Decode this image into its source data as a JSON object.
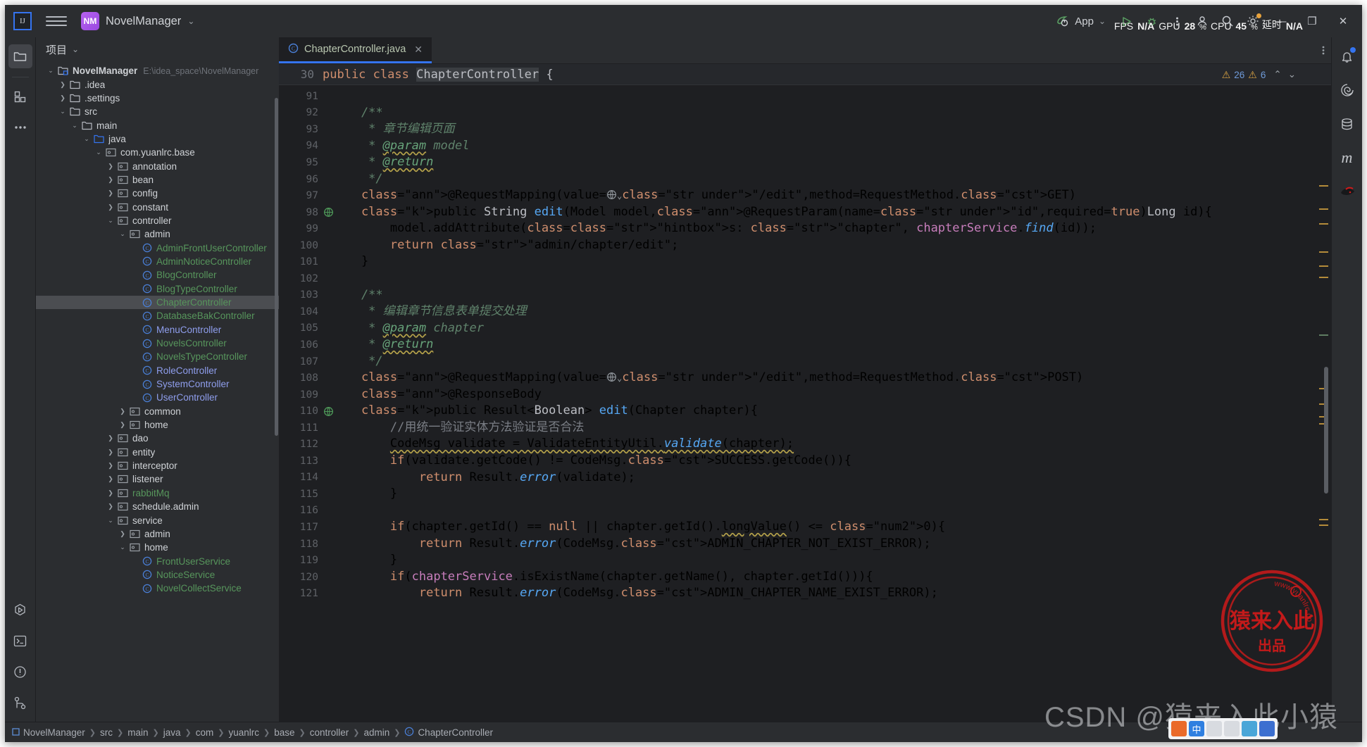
{
  "titlebar": {
    "ide_logo": "IJ",
    "menu_icon": "hamburger-menu-icon",
    "project_badge": "NM",
    "project_name": "NovelManager",
    "project_chevron": "⌄",
    "run_config": "App",
    "run_chevron": "⌄",
    "run_icon": "run-icon",
    "debug_icon": "debug-icon",
    "more_icon": "more-options-icon",
    "account_icon": "account-icon",
    "search_icon": "search-icon",
    "settings_icon": "settings-icon",
    "minimize": "—",
    "maximize": "❐",
    "close": "✕"
  },
  "perf_overlay": {
    "fps_label": "FPS",
    "fps_value": "N/A",
    "gpu_label": "GPU",
    "gpu_value": "28",
    "gpu_unit": "%",
    "cpu_label": "CPU",
    "cpu_value": "45",
    "cpu_unit": "%",
    "latency_label": "延时",
    "latency_value": "N/A"
  },
  "left_rail": [
    {
      "name": "project-tool-window",
      "icon": "folder-icon",
      "active": true
    },
    {
      "name": "structure-tool-window",
      "icon": "structure-grid-icon",
      "active": false
    },
    {
      "name": "more-tool-windows",
      "icon": "ellipsis-icon",
      "active": false
    }
  ],
  "left_rail_bottom": [
    {
      "name": "run-tool-window",
      "icon": "run-hexagon-icon"
    },
    {
      "name": "terminal-tool-window",
      "icon": "terminal-icon"
    },
    {
      "name": "problems-tool-window",
      "icon": "warning-circle-icon"
    },
    {
      "name": "version-control-tool-window",
      "icon": "branch-icon"
    }
  ],
  "right_rail": [
    {
      "name": "notifications",
      "icon": "bell-icon",
      "badge": true
    },
    {
      "name": "spring-tool-window",
      "icon": "spring-leaf-icon",
      "badge": false
    },
    {
      "name": "database-tool-window",
      "icon": "database-icon",
      "badge": false
    },
    {
      "name": "maven-tool-window",
      "icon": "maven-m-icon",
      "badge": false
    },
    {
      "name": "ninja-tool-window",
      "icon": "ninja-icon",
      "badge": false
    }
  ],
  "project_panel": {
    "title": "项目",
    "title_chevron": "⌄",
    "tree": [
      {
        "depth": 0,
        "arrow": "down",
        "icon": "module-icon",
        "label": "NovelManager",
        "style": "bold",
        "path": "E:\\idea_space\\NovelManager"
      },
      {
        "depth": 1,
        "arrow": "right",
        "icon": "folder-icon",
        "label": ".idea",
        "style": ""
      },
      {
        "depth": 1,
        "arrow": "right",
        "icon": "folder-icon",
        "label": ".settings",
        "style": ""
      },
      {
        "depth": 1,
        "arrow": "down",
        "icon": "folder-icon",
        "label": "src",
        "style": ""
      },
      {
        "depth": 2,
        "arrow": "down",
        "icon": "folder-icon",
        "label": "main",
        "style": ""
      },
      {
        "depth": 3,
        "arrow": "down",
        "icon": "source-folder-icon",
        "label": "java",
        "style": ""
      },
      {
        "depth": 4,
        "arrow": "down",
        "icon": "package-icon",
        "label": "com.yuanlrc.base",
        "style": ""
      },
      {
        "depth": 5,
        "arrow": "right",
        "icon": "package-icon",
        "label": "annotation",
        "style": ""
      },
      {
        "depth": 5,
        "arrow": "right",
        "icon": "package-icon",
        "label": "bean",
        "style": ""
      },
      {
        "depth": 5,
        "arrow": "right",
        "icon": "package-icon",
        "label": "config",
        "style": ""
      },
      {
        "depth": 5,
        "arrow": "right",
        "icon": "package-icon",
        "label": "constant",
        "style": ""
      },
      {
        "depth": 5,
        "arrow": "down",
        "icon": "package-icon",
        "label": "controller",
        "style": ""
      },
      {
        "depth": 6,
        "arrow": "down",
        "icon": "package-icon",
        "label": "admin",
        "style": ""
      },
      {
        "depth": 7,
        "arrow": "none",
        "icon": "class-icon",
        "label": "AdminFrontUserController",
        "style": "green"
      },
      {
        "depth": 7,
        "arrow": "none",
        "icon": "class-icon",
        "label": "AdminNoticeController",
        "style": "green"
      },
      {
        "depth": 7,
        "arrow": "none",
        "icon": "class-icon",
        "label": "BlogController",
        "style": "green"
      },
      {
        "depth": 7,
        "arrow": "none",
        "icon": "class-icon",
        "label": "BlogTypeController",
        "style": "green"
      },
      {
        "depth": 7,
        "arrow": "none",
        "icon": "class-icon",
        "label": "ChapterController",
        "style": "green",
        "selected": true
      },
      {
        "depth": 7,
        "arrow": "none",
        "icon": "class-icon",
        "label": "DatabaseBakController",
        "style": "green"
      },
      {
        "depth": 7,
        "arrow": "none",
        "icon": "class-icon",
        "label": "MenuController",
        "style": "blue"
      },
      {
        "depth": 7,
        "arrow": "none",
        "icon": "class-icon",
        "label": "NovelsController",
        "style": "green"
      },
      {
        "depth": 7,
        "arrow": "none",
        "icon": "class-icon",
        "label": "NovelsTypeController",
        "style": "green"
      },
      {
        "depth": 7,
        "arrow": "none",
        "icon": "class-icon",
        "label": "RoleController",
        "style": "blue"
      },
      {
        "depth": 7,
        "arrow": "none",
        "icon": "class-icon",
        "label": "SystemController",
        "style": "blue"
      },
      {
        "depth": 7,
        "arrow": "none",
        "icon": "class-icon",
        "label": "UserController",
        "style": "blue"
      },
      {
        "depth": 6,
        "arrow": "right",
        "icon": "package-icon",
        "label": "common",
        "style": ""
      },
      {
        "depth": 6,
        "arrow": "right",
        "icon": "package-icon",
        "label": "home",
        "style": ""
      },
      {
        "depth": 5,
        "arrow": "right",
        "icon": "package-icon",
        "label": "dao",
        "style": ""
      },
      {
        "depth": 5,
        "arrow": "right",
        "icon": "package-icon",
        "label": "entity",
        "style": ""
      },
      {
        "depth": 5,
        "arrow": "right",
        "icon": "package-icon",
        "label": "interceptor",
        "style": ""
      },
      {
        "depth": 5,
        "arrow": "right",
        "icon": "package-icon",
        "label": "listener",
        "style": ""
      },
      {
        "depth": 5,
        "arrow": "right",
        "icon": "package-icon",
        "label": "rabbitMq",
        "style": "green"
      },
      {
        "depth": 5,
        "arrow": "right",
        "icon": "package-icon",
        "label": "schedule.admin",
        "style": ""
      },
      {
        "depth": 5,
        "arrow": "down",
        "icon": "package-icon",
        "label": "service",
        "style": ""
      },
      {
        "depth": 6,
        "arrow": "right",
        "icon": "package-icon",
        "label": "admin",
        "style": ""
      },
      {
        "depth": 6,
        "arrow": "down",
        "icon": "package-icon",
        "label": "home",
        "style": ""
      },
      {
        "depth": 7,
        "arrow": "none",
        "icon": "class-icon",
        "label": "FrontUserService",
        "style": "green"
      },
      {
        "depth": 7,
        "arrow": "none",
        "icon": "class-icon",
        "label": "NoticeService",
        "style": "green"
      },
      {
        "depth": 7,
        "arrow": "none",
        "icon": "class-icon",
        "label": "NovelCollectService",
        "style": "green"
      }
    ]
  },
  "editor": {
    "tab": {
      "label": "ChapterController.java",
      "icon": "java-class-icon",
      "close": "✕"
    },
    "tab_actions_icon": "tab-more-icon",
    "sticky_line_number": "30",
    "sticky_code": "public class ChapterController {",
    "inspections": {
      "warning_icon": "warning-triangle-icon",
      "warning_count": "26",
      "weak_warning_icon": "weak-warning-triangle-icon",
      "weak_warning_count": "6",
      "prev_icon": "chevron-up-icon",
      "next_icon": "chevron-down-icon"
    },
    "first_line": 91,
    "lines": [
      {
        "n": 91,
        "text": ""
      },
      {
        "n": 92,
        "text": "    /**"
      },
      {
        "n": 93,
        "text": "     * 章节编辑页面"
      },
      {
        "n": 94,
        "text": "     * @param model"
      },
      {
        "n": 95,
        "text": "     * @return"
      },
      {
        "n": 96,
        "text": "     */"
      },
      {
        "n": 97,
        "text": "    @RequestMapping(value=\"/edit\",method=RequestMethod.GET)"
      },
      {
        "n": 98,
        "text": "    public String edit(Model model,@RequestParam(name=\"id\",required=true)Long id){",
        "gutter_mark": "web-mapping-icon"
      },
      {
        "n": 99,
        "text": "        model.addAttribute( s: \"chapter\", chapterService.find(id));"
      },
      {
        "n": 100,
        "text": "        return \"admin/chapter/edit\";"
      },
      {
        "n": 101,
        "text": "    }"
      },
      {
        "n": 102,
        "text": ""
      },
      {
        "n": 103,
        "text": "    /**"
      },
      {
        "n": 104,
        "text": "     * 编辑章节信息表单提交处理"
      },
      {
        "n": 105,
        "text": "     * @param chapter"
      },
      {
        "n": 106,
        "text": "     * @return"
      },
      {
        "n": 107,
        "text": "     */"
      },
      {
        "n": 108,
        "text": "    @RequestMapping(value=\"/edit\",method=RequestMethod.POST)"
      },
      {
        "n": 109,
        "text": "    @ResponseBody"
      },
      {
        "n": 110,
        "text": "    public Result<Boolean> edit(Chapter chapter){",
        "gutter_mark": "web-mapping-icon"
      },
      {
        "n": 111,
        "text": "        //用统一验证实体方法验证是否合法"
      },
      {
        "n": 112,
        "text": "        CodeMsg validate = ValidateEntityUtil.validate(chapter);"
      },
      {
        "n": 113,
        "text": "        if(validate.getCode() != CodeMsg.SUCCESS.getCode()){"
      },
      {
        "n": 114,
        "text": "            return Result.error(validate);"
      },
      {
        "n": 115,
        "text": "        }"
      },
      {
        "n": 116,
        "text": ""
      },
      {
        "n": 117,
        "text": "        if(chapter.getId() == null || chapter.getId().longValue() <= 0){"
      },
      {
        "n": 118,
        "text": "            return Result.error(CodeMsg.ADMIN_CHAPTER_NOT_EXIST_ERROR);"
      },
      {
        "n": 119,
        "text": "        }"
      },
      {
        "n": 120,
        "text": "        if(chapterService.isExistName(chapter.getName(), chapter.getId())){"
      },
      {
        "n": 121,
        "text": "            return Result.error(CodeMsg.ADMIN_CHAPTER_NAME_EXIST_ERROR);"
      }
    ]
  },
  "breadcrumb": {
    "items": [
      {
        "label": "NovelManager",
        "icon": "module-icon"
      },
      {
        "label": "src",
        "icon": ""
      },
      {
        "label": "main",
        "icon": ""
      },
      {
        "label": "java",
        "icon": ""
      },
      {
        "label": "com",
        "icon": ""
      },
      {
        "label": "yuanlrc",
        "icon": ""
      },
      {
        "label": "base",
        "icon": ""
      },
      {
        "label": "controller",
        "icon": ""
      },
      {
        "label": "admin",
        "icon": ""
      },
      {
        "label": "ChapterController",
        "icon": "class-icon"
      }
    ],
    "separator": "❯"
  },
  "watermark": {
    "stamp_url_text": "www.yuanlrc.com",
    "stamp_main": "猿来入此",
    "stamp_sub": "出品",
    "csdn_text": "CSDN @猿来入此小猿",
    "ime_text": "中"
  },
  "colors": {
    "accent": "#3574f0",
    "panel_bg": "#2b2d30",
    "editor_bg": "#1e1f22",
    "string": "#6aab73",
    "keyword": "#cf8e6d",
    "annotation": "#b3ae60",
    "comment": "#7a7e85",
    "warning": "#d9a343",
    "stamp_red": "#d11a1a"
  }
}
